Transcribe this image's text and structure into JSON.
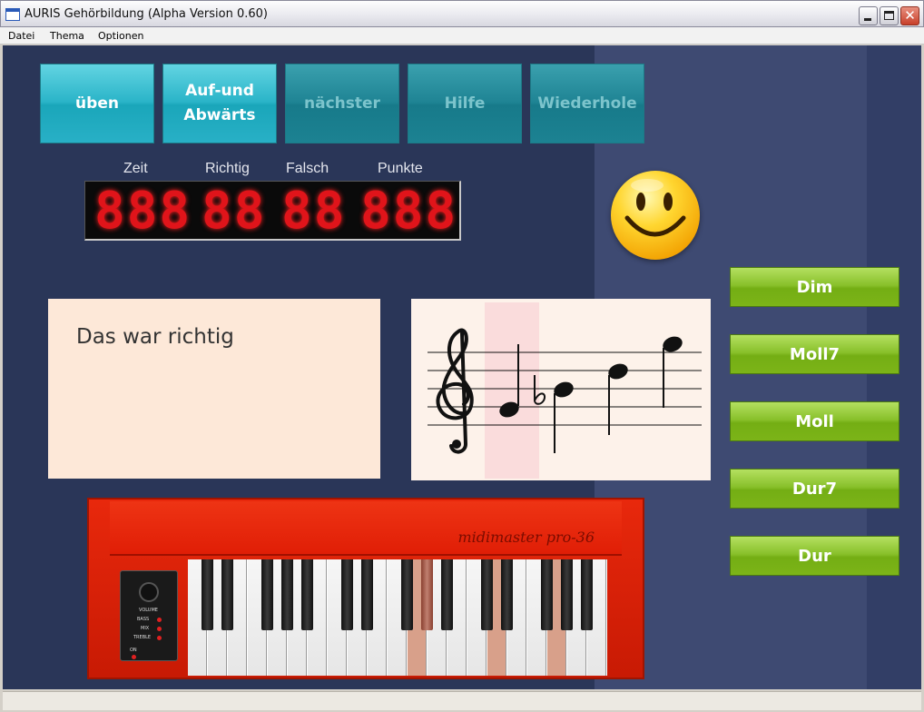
{
  "window": {
    "title": "AURIS Gehörbildung (Alpha Version 0.60)",
    "close_glyph": "✕"
  },
  "menu": [
    "Datei",
    "Thema",
    "Optionen"
  ],
  "toolbar": {
    "practice": "üben",
    "updown": "Auf-und\nAbwärts",
    "next": "nächster",
    "help": "Hilfe",
    "repeat": "Wiederhole"
  },
  "score": {
    "time_label": "Zeit",
    "correct_label": "Richtig",
    "wrong_label": "Falsch",
    "points_label": "Punkte",
    "time_digits": "888",
    "correct_digits": "88",
    "wrong_digits": "88",
    "points_digits": "888"
  },
  "feedback": {
    "message": "Das war richtig"
  },
  "answers": [
    "Dim",
    "Moll7",
    "Moll",
    "Dur7",
    "Dur"
  ],
  "keyboard": {
    "brand": "midimaster  pro-36",
    "panel_labels": [
      "VOLUME",
      "BASS",
      "MIX",
      "TREBLE",
      "ON"
    ],
    "highlighted_white_keys": [
      11,
      15,
      18
    ],
    "highlighted_black_keys": [
      8
    ]
  },
  "colors": {
    "background": "#2a3658",
    "teal_active": "#2ab4c8",
    "teal_inactive": "#1f8494",
    "green_button": "#88c02a",
    "led_red": "#e0141a",
    "keyboard_red": "#e01e06"
  }
}
